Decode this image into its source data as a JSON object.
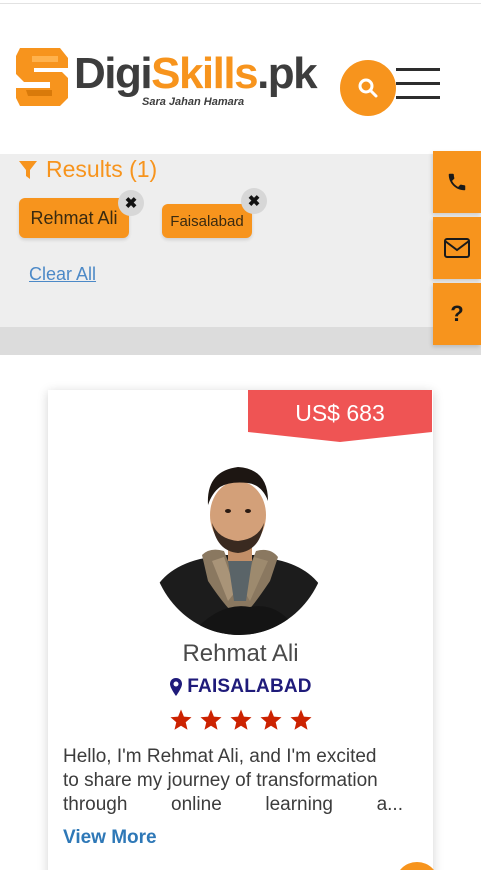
{
  "brand": {
    "name_digi": "Digi",
    "name_skills": "Skills",
    "name_pk": ".pk",
    "tagline": "Sara Jahan Hamara",
    "orange": "#f7941d",
    "dark": "#3d3d3d"
  },
  "header": {
    "search_icon": "search-icon",
    "menu_icon": "hamburger-menu-icon"
  },
  "filters": {
    "results_label": "Results (1)",
    "chips": [
      "Rehmat Ali",
      "Faisalabad"
    ],
    "remove_symbol": "✖",
    "clear_all": "Clear All"
  },
  "side_actions": {
    "help_label": "?"
  },
  "card": {
    "price": "US$ 683",
    "price_color": "#ef5454",
    "name": "Rehmat Ali",
    "location": "FAISALABAD",
    "rating": 5,
    "star_color": "#cc2200",
    "bio_line_1": "Hello, I'm Rehmat Ali, and I'm excited",
    "bio_line_2": "to share my journey of transformation",
    "bio_line_3": "through online learning a...",
    "view_more": "View More"
  }
}
